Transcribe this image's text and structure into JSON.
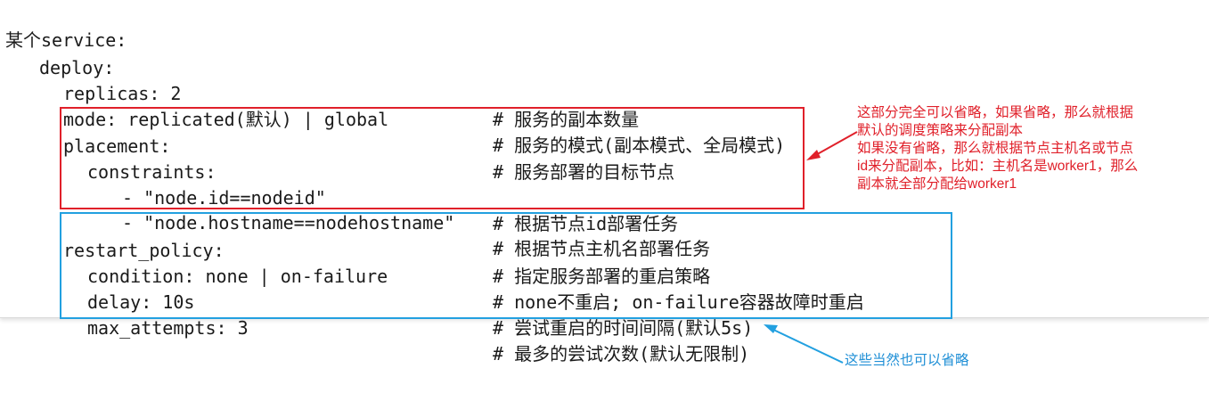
{
  "code": {
    "lines": [
      {
        "code": "某个service:",
        "comment": ""
      },
      {
        "code": "deploy:",
        "comment": ""
      },
      {
        "code": "replicas: 2",
        "comment": "# 服务的副本数量"
      },
      {
        "code": "mode: replicated(默认) | global",
        "comment": "# 服务的模式(副本模式、全局模式)"
      },
      {
        "code": "placement:",
        "comment": "# 服务部署的目标节点"
      },
      {
        "code": "constraints:",
        "comment": ""
      },
      {
        "code": "- \"node.id==nodeid\"",
        "comment": "# 根据节点id部署任务"
      },
      {
        "code": "- \"node.hostname==nodehostname\"",
        "comment": "# 根据节点主机名部署任务"
      },
      {
        "code": "restart_policy:",
        "comment": "# 指定服务部署的重启策略"
      },
      {
        "code": "condition: none | on-failure",
        "comment": "# none不重启; on-failure容器故障时重启"
      },
      {
        "code": "delay: 10s",
        "comment": "# 尝试重启的时间间隔(默认5s)"
      },
      {
        "code": "max_attempts: 3",
        "comment": "# 最多的尝试次数(默认无限制)"
      }
    ]
  },
  "annotations": {
    "red_note": "这部分完全可以省略，如果省略，那么就根据\n默认的调度策略来分配副本\n如果没有省略，那么就根据节点主机名或节点\nid来分配副本，比如：主机名是worker1，那么\n副本就全部分配给worker1",
    "blue_note": "这些当然也可以省略",
    "colors": {
      "red": "#e0202a",
      "blue": "#22a0e0"
    }
  }
}
